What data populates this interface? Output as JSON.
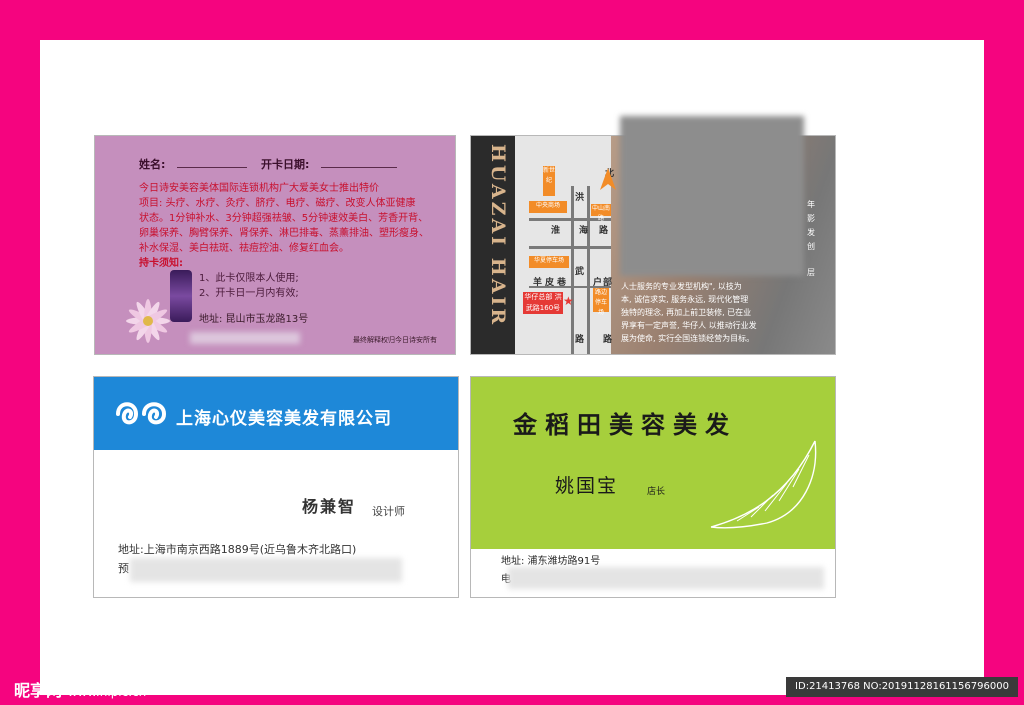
{
  "card1": {
    "name_label": "姓名:",
    "date_label": "开卡日期:",
    "intro": "今日诗安美容美体国际连锁机构广大爱美女士推出特价",
    "line_a": "项目: 头疗、水疗、灸疗、脐疗、电疗、磁疗、改变人体亚健康",
    "line_b": "状态。1分钟补水、3分钟超强祛皱、5分钟速效美白、芳香开背、",
    "line_c": "卵巢保养、胸臂保养、肾保养、淋巴排毒、蒸薰排油、塑形瘦身、",
    "line_d": "补水保湿、美白祛斑、祛痘控油、修复红血会。",
    "notice_title": "持卡须知:",
    "notice_1": "1、此卡仅限本人使用;",
    "notice_2": "2、开卡日一月内有效;",
    "address": "地址: 昆山市玉龙路13号",
    "footer": "最终解释权归今日诗安所有"
  },
  "card2": {
    "brand": "HUAZAI HAIR",
    "map_labels": {
      "hong": "洪",
      "wu": "武",
      "lu_mid": "路",
      "huai": "淮",
      "hai": "海",
      "lu_top": "路",
      "yang": "羊",
      "pi": "皮",
      "xiang": "巷",
      "hu": "户",
      "bu": "部",
      "lu_bot": "路",
      "north": "北"
    },
    "map_boxes": [
      "新世纪",
      "中央商场",
      "华夏停车场",
      "华仔总部 洪武路160号",
      "路边停车场",
      "中山南路"
    ],
    "side_1": "年",
    "side_2": "影",
    "side_3": "发",
    "side_4": "创",
    "side_5": "层",
    "text_1": "人士服务的专业发型机构\", 以技为",
    "text_2": "本, 诚信求实, 服务永远, 现代化管理",
    "text_3": "独特的理念, 再加上前卫装修, 已在业",
    "text_4": "界享有一定声誉, 华仔人 以推动行业发",
    "text_5": "展为使命, 实行全国连锁经营为目标。"
  },
  "card3": {
    "company": "上海心仪美容美发有限公司",
    "person": "杨兼智",
    "title": "设计师",
    "address": "地址:上海市南京西路1889号(近乌鲁木齐北路口)",
    "prefix": "预"
  },
  "card4": {
    "company": "金稻田美容美发",
    "person": "姚国宝",
    "title": "店长",
    "address": "地址: 浦东潍坊路91号",
    "prefix": "电"
  },
  "watermark": {
    "logo": "昵享网",
    "url": "www.nipic.cn",
    "id": "ID:21413768 NO:20191128161156796000"
  },
  "colors": {
    "frame": "#f5047f",
    "card1_bg": "#c58fbd",
    "card3_band": "#1e88d8",
    "card4_green": "#a6cf3c"
  }
}
